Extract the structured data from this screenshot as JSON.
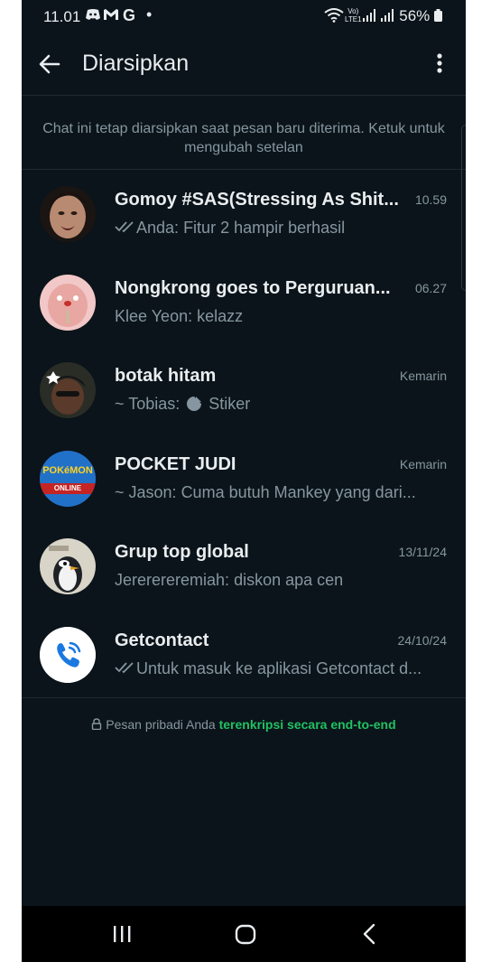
{
  "status_bar": {
    "time": "11.01",
    "notif_icons": [
      "discord-icon",
      "gmail-icon",
      "google-icon",
      "dot-icon"
    ],
    "network_label_top": "Vo)",
    "network_label_bottom": "LTE1",
    "battery": "56%"
  },
  "header": {
    "title": "Diarsipkan"
  },
  "info_text": "Chat ini tetap diarsipkan saat pesan baru diterima. Ketuk untuk mengubah setelan",
  "chats": [
    {
      "name": "Gomoy #SAS(Stressing As Shit...",
      "time": "10.59",
      "sender": "Anda:",
      "preview": "Fitur 2 hampir berhasil",
      "ticks": true
    },
    {
      "name": "Nongkrong goes to Perguruan...",
      "time": "06.27",
      "sender": "Klee Yeon:",
      "preview": "kelazz",
      "ticks": false
    },
    {
      "name": "botak hitam",
      "time": "Kemarin",
      "sender": "~ Tobias:",
      "preview": "Stiker",
      "ticks": false
    },
    {
      "name": "POCKET JUDI",
      "time": "Kemarin",
      "sender": "~ Jason:",
      "preview": "Cuma butuh Mankey yang dari...",
      "ticks": false
    },
    {
      "name": "Grup top global",
      "time": "13/11/24",
      "sender": "Jererereremiah:",
      "preview": "diskon apa cen",
      "ticks": false
    },
    {
      "name": "Getcontact",
      "time": "24/10/24",
      "sender": "",
      "preview": "Untuk masuk ke aplikasi Getcontact d...",
      "ticks": true
    }
  ],
  "avatar_labels": {
    "pocket_top": "POKéMON",
    "pocket_bottom": "ONLINE"
  },
  "footer": {
    "encryption_prefix": "Pesan pribadi Anda",
    "encryption_link": "terenkripsi secara end-to-end"
  },
  "colors": {
    "background": "#0b141a",
    "accent_green": "#21c063",
    "text_primary": "#e9edef",
    "text_secondary": "#8696a0"
  }
}
